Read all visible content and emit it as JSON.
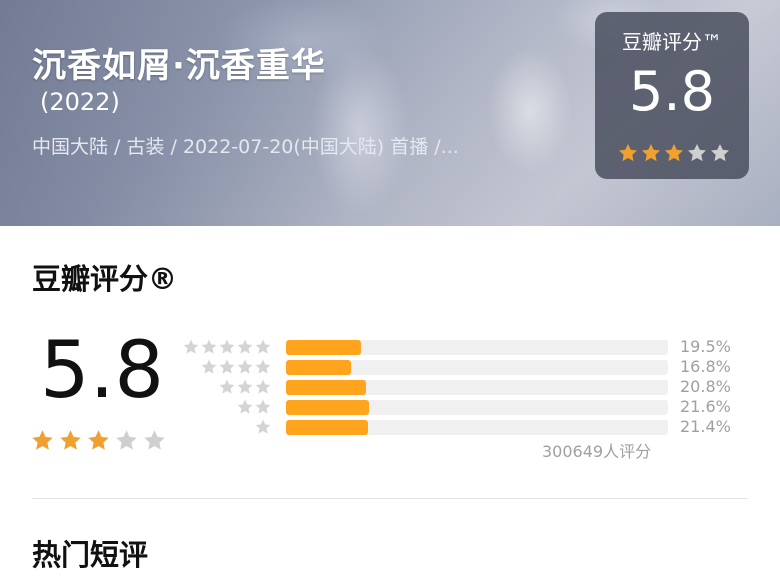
{
  "header": {
    "title": "沉香如屑·沉香重华",
    "year": "(2022)",
    "meta": "中国大陆 / 古装 / 2022-07-20(中国大陆) 首播 /..."
  },
  "badge": {
    "label": "豆瓣评分™",
    "score": "5.8",
    "stars_filled": 3,
    "stars_total": 5
  },
  "rating": {
    "section_title": "豆瓣评分®",
    "score": "5.8",
    "stars_filled": 3,
    "stars_total": 5,
    "distribution": [
      {
        "stars": 5,
        "percent": "19.5%",
        "value": 19.5
      },
      {
        "stars": 4,
        "percent": "16.8%",
        "value": 16.8
      },
      {
        "stars": 3,
        "percent": "20.8%",
        "value": 20.8
      },
      {
        "stars": 2,
        "percent": "21.6%",
        "value": 21.6
      },
      {
        "stars": 1,
        "percent": "21.4%",
        "value": 21.4
      }
    ],
    "count": "300649人评分"
  },
  "reviews": {
    "section_title": "热门短评"
  },
  "colors": {
    "accent": "#ffa41c",
    "star_filled": "#f0a030",
    "star_empty": "#cfcfcf",
    "badge_bg": "#464a5a"
  }
}
